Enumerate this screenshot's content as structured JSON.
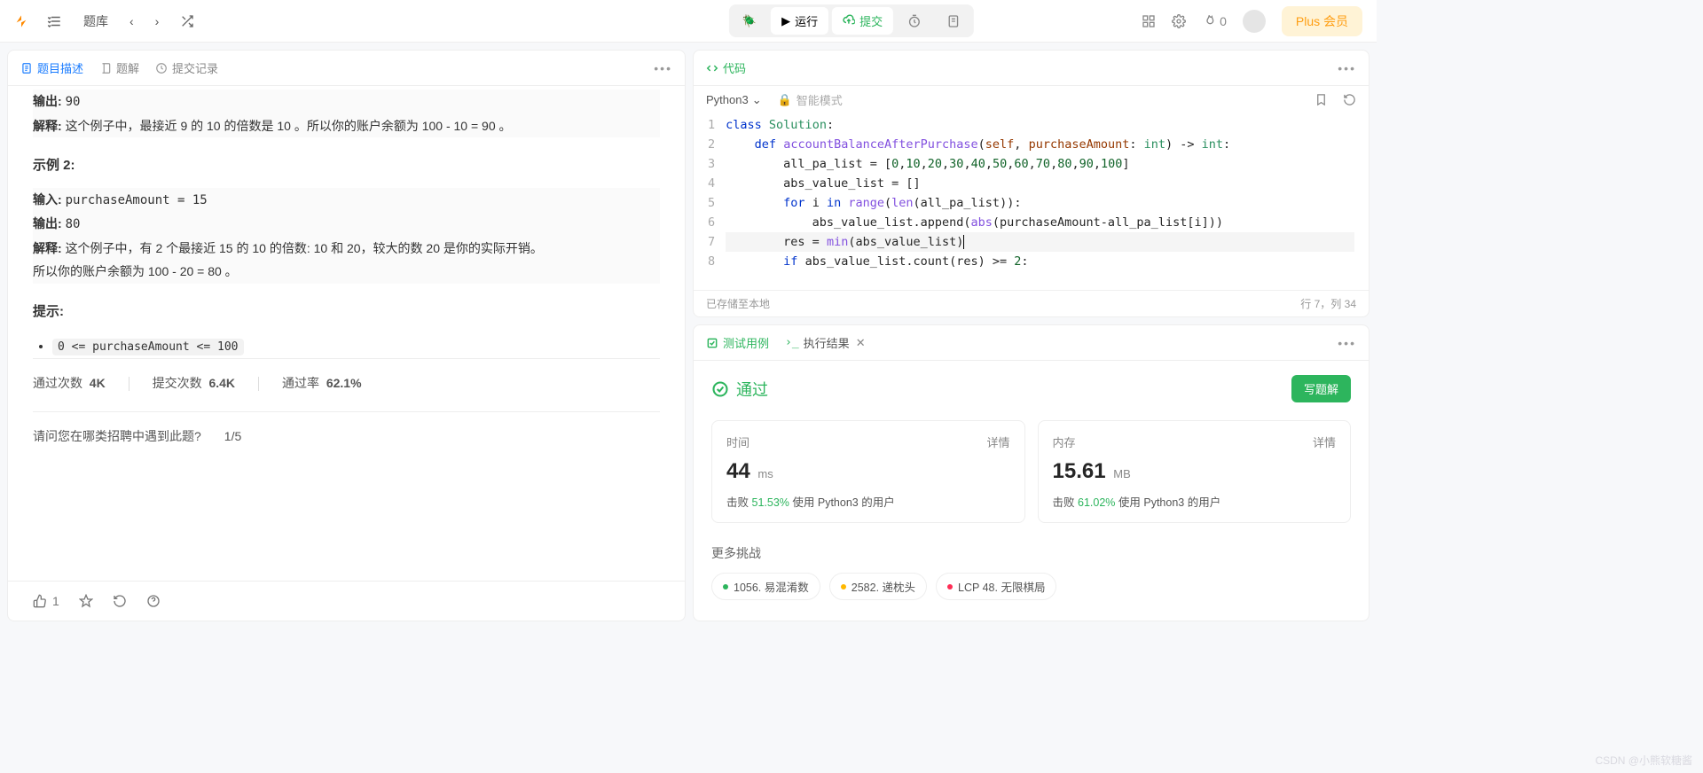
{
  "topbar": {
    "problems_label": "题库",
    "run_label": "运行",
    "submit_label": "提交",
    "fire_count": "0",
    "plus_label": "Plus 会员"
  },
  "left": {
    "tabs": {
      "desc": "题目描述",
      "solution": "题解",
      "submissions": "提交记录"
    },
    "truncated_output_label": "输出:",
    "truncated_output_value": "90",
    "truncated_explain_label": "解释:",
    "truncated_explain_text": "这个例子中，最接近 9 的 10 的倍数是 10 。所以你的账户余额为 100 - 10 = 90 。",
    "example2_title": "示例 2:",
    "ex2_input_label": "输入:",
    "ex2_input_value": "purchaseAmount = 15",
    "ex2_output_label": "输出:",
    "ex2_output_value": "80",
    "ex2_explain_label": "解释:",
    "ex2_explain_line1": "这个例子中，有 2 个最接近 15 的 10 的倍数: 10 和 20，较大的数 20 是你的实际开销。",
    "ex2_explain_line2": "所以你的账户余额为 100 - 20 = 80 。",
    "hint_title": "提示:",
    "constraint1": "0 <= purchaseAmount <= 100",
    "stats": {
      "pass_count_label": "通过次数",
      "pass_count": "4K",
      "submit_count_label": "提交次数",
      "submit_count": "6.4K",
      "pass_rate_label": "通过率",
      "pass_rate": "62.1%"
    },
    "feedback_q": "请问您在哪类招聘中遇到此题?",
    "feedback_progress": "1/5",
    "like_count": "1"
  },
  "code": {
    "tab_label": "代码",
    "lang": "Python3",
    "smart_mode": "智能模式",
    "lines": [
      {
        "n": "1",
        "html": "<span class='kw'>class</span> <span class='cls'>Solution</span>:"
      },
      {
        "n": "2",
        "html": "    <span class='kw'>def</span> <span class='fn'>accountBalanceAfterPurchase</span>(<span class='var'>self</span>, <span class='var'>purchaseAmount</span>: <span class='cls'>int</span>) -> <span class='cls'>int</span>:"
      },
      {
        "n": "3",
        "html": "        all_pa_list = [<span class='num'>0</span>,<span class='num'>10</span>,<span class='num'>20</span>,<span class='num'>30</span>,<span class='num'>40</span>,<span class='num'>50</span>,<span class='num'>60</span>,<span class='num'>70</span>,<span class='num'>80</span>,<span class='num'>90</span>,<span class='num'>100</span>]"
      },
      {
        "n": "4",
        "html": "        abs_value_list = []"
      },
      {
        "n": "5",
        "html": "        <span class='kw'>for</span> i <span class='kw'>in</span> <span class='fn'>range</span>(<span class='fn'>len</span>(all_pa_list)):"
      },
      {
        "n": "6",
        "html": "            abs_value_list.append(<span class='fn'>abs</span>(purchaseAmount-all_pa_list[i]))"
      },
      {
        "n": "7",
        "html": "        res = <span class='fn'>min</span>(abs_value_list)<span style='border-right:1px solid #000'></span>",
        "cur": true
      },
      {
        "n": "8",
        "html": "        <span class='kw'>if</span> abs_value_list.count(res) >= <span class='num'>2</span>:"
      }
    ],
    "status_saved": "已存储至本地",
    "status_pos": "行 7，列 34"
  },
  "results": {
    "tab_test": "测试用例",
    "tab_result": "执行结果",
    "pass_label": "通过",
    "write_solution": "写题解",
    "time": {
      "label": "时间",
      "detail": "详情",
      "value": "44",
      "unit": "ms",
      "beat_label": "击败",
      "beat_pct": "51.53%",
      "suffix": "使用 Python3 的用户"
    },
    "mem": {
      "label": "内存",
      "detail": "详情",
      "value": "15.61",
      "unit": "MB",
      "beat_label": "击败",
      "beat_pct": "61.02%",
      "suffix": "使用 Python3 的用户"
    },
    "more_title": "更多挑战",
    "chips": [
      {
        "dot": "g",
        "text": "1056. 易混淆数"
      },
      {
        "dot": "y",
        "text": "2582. 递枕头"
      },
      {
        "dot": "r",
        "text": "LCP 48. 无限棋局"
      }
    ]
  },
  "watermark": "CSDN @小熊软糖酱"
}
